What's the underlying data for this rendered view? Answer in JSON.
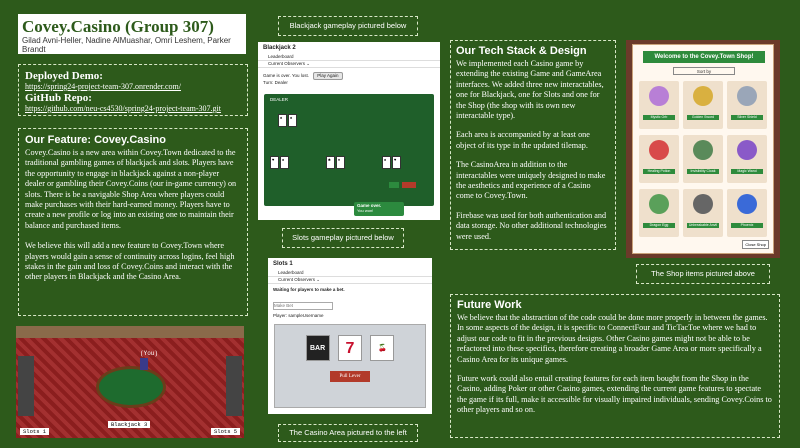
{
  "header": {
    "title": "Covey.Casino (Group 307)",
    "authors": "Gilad Avni-Heller, Nadine AlMuashar, Omri Leshem, Parker Brandt"
  },
  "links": {
    "demo_heading": "Deployed Demo:",
    "demo_url": "https://spring24-project-team-307.onrender.com/",
    "repo_heading": "GitHub Repo:",
    "repo_url": "https://github.com/neu-cs4530/spring24-project-team-307.git"
  },
  "feature": {
    "heading": "Our Feature: Covey.Casino",
    "p1": "Covey.Casino is a new area within Covey.Town dedicated to the traditional gambling games of blackjack and slots. Players have the opportunity to engage in blackjack against a non-player dealer or gambling their Covey.Coins (our in-game currency) on slots. There is be a navigable Shop Area where players could make purchases with their hard-earned money. Players have to create a new profile or log into an existing one to maintain their balance and purchased items.",
    "p2": "We believe this will add a new feature to Covey.Town where players would gain a sense of continuity across logins, feel high stakes in the gain and loss of Covey.Coins and interact with the other players in Blackjack and the Casino Area."
  },
  "captions": {
    "blackjack": "Blackjack gameplay pictured below",
    "slots": "Slots gameplay pictured below",
    "casino": "The Casino Area pictured to the left",
    "shop": "The Shop items pictured above"
  },
  "blackjack_shot": {
    "title": "Blackjack 2",
    "leaderboard": "Leaderboard",
    "observers": "Current Observers ⌄",
    "status": "Game is over. You lost.",
    "play_again": "Play Again",
    "turn": "Turn: Dealer",
    "dealer_label": "DEALER",
    "toast": "Game over.",
    "toast_sub": "You won!"
  },
  "slots_shot": {
    "title": "Slots 1",
    "leaderboard": "Leaderboard",
    "observers": "Current Observers ⌄",
    "waiting": "Waiting for players to make a bet.",
    "bet_placeholder": "Make Bet",
    "player": "Player: sampleUsername",
    "reel1": "BAR",
    "reel2": "7",
    "reel3": "🍒",
    "pull_lever": "Pull Lever"
  },
  "casino_shot": {
    "you_tag": "(You)",
    "blackjack_sign": "Blackjack 3",
    "slots_left": "Slots 1",
    "slots_right": "Slots 5"
  },
  "shop_shot": {
    "title": "Welcome to the Covey.Town Shop!",
    "sort": "Sort by",
    "close": "Close Shop",
    "items": [
      "Mystic Orb",
      "Golden Sword",
      "Silver Shield",
      "Healing Potion",
      "Invisibility Cloak",
      "Magic Wand",
      "Dragon Egg",
      "Unbreakable Anvil",
      "Phoenix"
    ]
  },
  "tech": {
    "heading": "Our Tech Stack & Design",
    "p1": "We implemented each Casino game by extending the existing Game and GameArea interfaces. We added three new interactables, one for Blackjack, one for Slots and one for the Shop (the shop with its own new interactable type).",
    "p2": "Each area is accompanied by at least one object of its type in the updated tilemap.",
    "p3": "The CasinoArea in addition to the interactables were uniquely designed to make the aesthetics and experience of a Casino come to Covey.Town.",
    "p4": "Firebase was used for both authentication and data storage. No other additional technologies were used."
  },
  "future": {
    "heading": "Future Work",
    "p1": "We believe that the abstraction of the code could be done more properly in between the games. In some aspects of the design, it is specific to ConnectFour and TicTacToe where we had to adjust our code to fit in the previous designs. Other Casino games might not be able to be refactored into these specifics, therefore creating a broader Game Area or more specifically a Casino Area for its unique games.",
    "p2": "Future work could also entail creating features for each item bought from the Shop in the Casino, adding Poker or other Casino games, extending the current game features to spectate the game if its full, make it accessible for visually impaired individuals, sending Covey.Coins to other players and so on."
  }
}
